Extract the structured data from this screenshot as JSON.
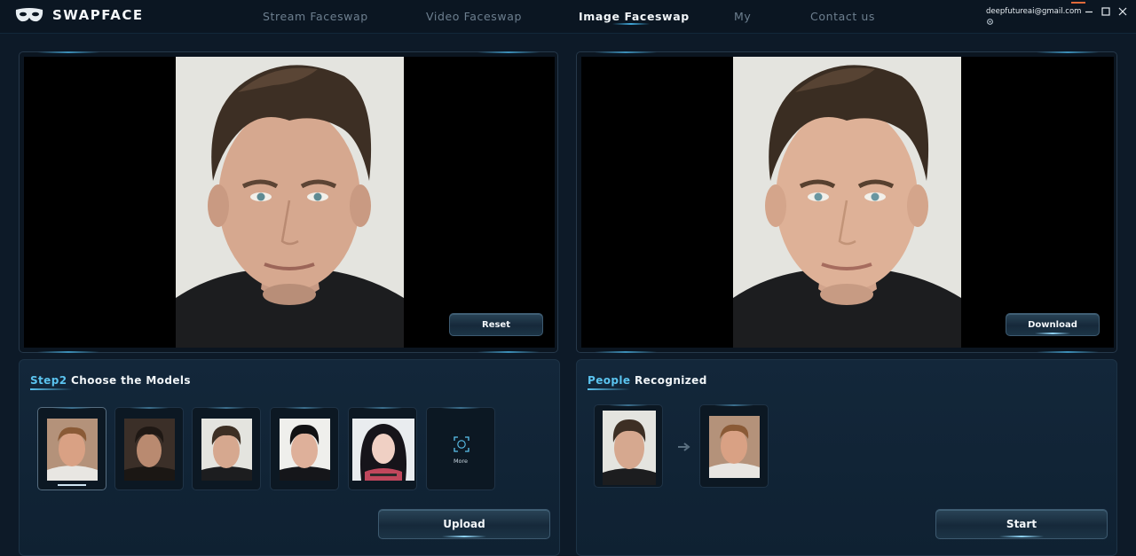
{
  "app": {
    "title": "SWAPFACE",
    "account_email": "deepfutureai@gmail.com"
  },
  "nav": {
    "items": [
      {
        "label": "Stream Faceswap"
      },
      {
        "label": "Video Faceswap"
      },
      {
        "label": "Image Faceswap",
        "active": true
      },
      {
        "label": "My"
      },
      {
        "label": "Contact us"
      }
    ]
  },
  "window_controls": [
    "minimize-icon",
    "maximize-icon",
    "close-icon"
  ],
  "source_view": {
    "image": "portrait of a man with swept-back brown hair, dark shirt, light background",
    "reset_label": "Reset"
  },
  "result_view": {
    "image": "face-swapped portrait of a man with brown hair, dark shirt, light background",
    "download_label": "Download"
  },
  "models_panel": {
    "title_highlight": "Step2",
    "title_rest": " Choose the Models",
    "models": [
      {
        "name": "model-1",
        "selected": true
      },
      {
        "name": "model-2"
      },
      {
        "name": "model-3"
      },
      {
        "name": "model-4"
      },
      {
        "name": "model-5"
      }
    ],
    "more_label": "More",
    "upload_label": "Upload"
  },
  "people_panel": {
    "title_highlight": "People",
    "title_rest": " Recognized",
    "arrow_icon": "arrow-right-icon",
    "start_label": "Start"
  },
  "colors": {
    "background": "#0d1a28",
    "accent": "#5bc3ef",
    "panel": "#13273a"
  }
}
